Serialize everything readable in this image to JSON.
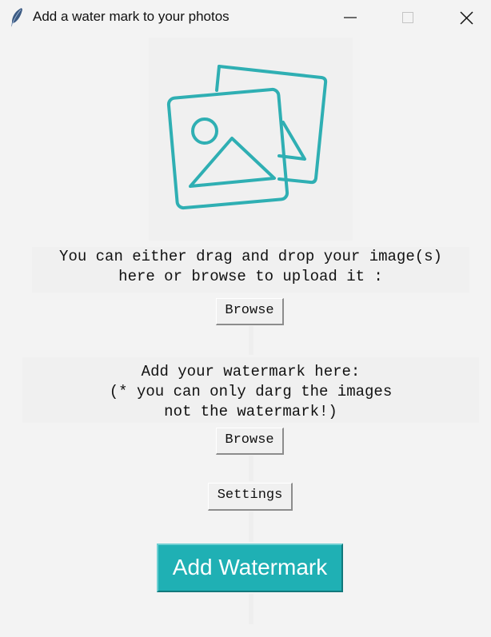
{
  "window": {
    "title": "Add a water mark to your photos",
    "app_icon": "feather-icon",
    "controls": {
      "minimize_icon": "minimize-icon",
      "maximize_icon": "maximize-icon",
      "close_icon": "close-icon"
    }
  },
  "image_preview": {
    "icon": "image-gallery-icon",
    "icon_color": "#2fafb3"
  },
  "upload": {
    "instruction_line1": "You can either drag and drop your image(s)",
    "instruction_line2": "here or browse to upload it :",
    "browse_label": "Browse"
  },
  "watermark": {
    "instruction_line1": "Add your watermark here:",
    "instruction_line2": "(* you can only darg the images",
    "instruction_line3": "not the watermark!)",
    "browse_label": "Browse"
  },
  "settings": {
    "label": "Settings"
  },
  "action": {
    "label": "Add Watermark",
    "color": "#1fb0b4"
  }
}
